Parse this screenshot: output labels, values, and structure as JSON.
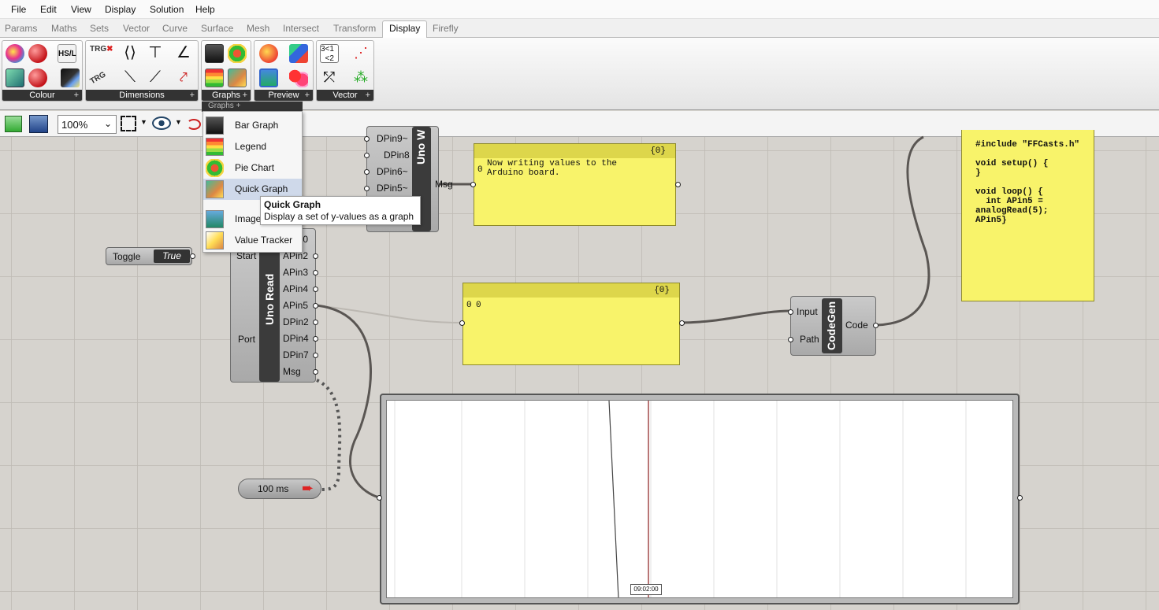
{
  "menubar": {
    "items": [
      "File",
      "Edit",
      "View",
      "Display",
      "Solution",
      "Help"
    ]
  },
  "tabs": [
    "Params",
    "Maths",
    "Sets",
    "Vector",
    "Curve",
    "Surface",
    "Mesh",
    "Intersect",
    "Transform",
    "Display",
    "Firefly"
  ],
  "active_tab": "Display",
  "ribbon": {
    "groups": [
      "Colour",
      "Dimensions",
      "Graphs",
      "Preview",
      "Vector"
    ],
    "colour_hsl_label": "HS/L",
    "dim_trg_label": "TRG"
  },
  "toolbar": {
    "zoom_value": "100%"
  },
  "dropdown": {
    "header": "Graphs",
    "items": [
      "Bar Graph",
      "Legend",
      "Pie Chart",
      "Quick Graph",
      "Image",
      "Value Tracker"
    ],
    "highlighted": "Quick Graph"
  },
  "tooltip": {
    "title": "Quick Graph",
    "desc": "Display a set of y-values as a graph"
  },
  "toggle": {
    "label": "Toggle",
    "value": "True"
  },
  "uno_write": {
    "title": "Uno W",
    "inputs": [
      "DPin9~",
      "DPin8",
      "DPin6~",
      "DPin5~"
    ],
    "output": "Msg"
  },
  "uno_read": {
    "title": "Uno Read",
    "inputs": [
      "Start",
      "Port"
    ],
    "outputs": [
      "APin0",
      "APin2",
      "APin3",
      "APin4",
      "APin5",
      "DPin2",
      "DPin4",
      "DPin7",
      "Msg"
    ]
  },
  "panel_msg": {
    "header": "{0}",
    "index": "0",
    "text": "Now writing values to the\nArduino board."
  },
  "panel_value": {
    "header": "{0}",
    "index": "0",
    "text": "0"
  },
  "codegen": {
    "title": "CodeGen",
    "inputs": [
      "Input",
      "Path"
    ],
    "output": "Code"
  },
  "code_panel": {
    "text": "#include \"FFCasts.h\"\n\nvoid setup() {\n}\n\nvoid loop() {\n  int APin5 =\nanalogRead(5);\nAPin5}"
  },
  "timer": {
    "label": "100 ms"
  },
  "graph": {
    "time_label": "09:02:00"
  }
}
